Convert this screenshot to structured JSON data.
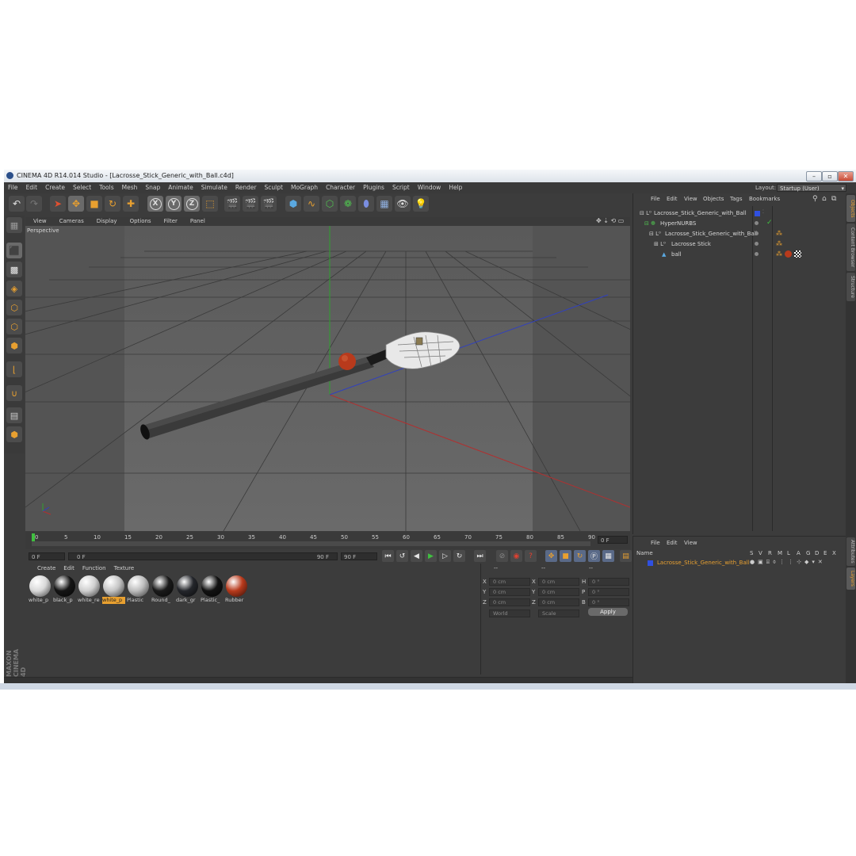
{
  "window": {
    "title": "CINEMA 4D R14.014 Studio - [Lacrosse_Stick_Generic_with_Ball.c4d]"
  },
  "menu": [
    "File",
    "Edit",
    "Create",
    "Select",
    "Tools",
    "Mesh",
    "Snap",
    "Animate",
    "Simulate",
    "Render",
    "Sculpt",
    "MoGraph",
    "Character",
    "Plugins",
    "Script",
    "Window",
    "Help"
  ],
  "layout": {
    "label": "Layout:",
    "value": "Startup (User)"
  },
  "viewport": {
    "menu": [
      "View",
      "Cameras",
      "Display",
      "Options",
      "Filter",
      "Panel"
    ],
    "label": "Perspective"
  },
  "timeline": {
    "ticks": [
      "0",
      "5",
      "10",
      "15",
      "20",
      "25",
      "30",
      "35",
      "40",
      "45",
      "50",
      "55",
      "60",
      "65",
      "70",
      "75",
      "80",
      "85",
      "90"
    ],
    "current_frame": "0 F",
    "start_field": "0 F",
    "range_start": "0 F",
    "range_end": "90 F",
    "end_field": "90 F"
  },
  "materials": {
    "menu": [
      "Create",
      "Edit",
      "Function",
      "Texture"
    ],
    "items": [
      {
        "label": "white_p",
        "color": "#d9d9d9"
      },
      {
        "label": "black_p",
        "color": "#151515"
      },
      {
        "label": "white_re",
        "color": "#cfcfcf"
      },
      {
        "label": "white_p",
        "color": "#c4c4c4",
        "selected": true
      },
      {
        "label": "Plastic",
        "color": "#bdbdbd"
      },
      {
        "label": "Round_",
        "color": "#1a1a1a"
      },
      {
        "label": "dark_gr",
        "color": "#24262b"
      },
      {
        "label": "Plastic_",
        "color": "#121212"
      },
      {
        "label": "Rubber",
        "color": "#b83a1c"
      }
    ]
  },
  "coordinates": {
    "header": [
      "--",
      "--",
      "--"
    ],
    "rows": [
      {
        "a": "X",
        "av": "0 cm",
        "b": "X",
        "bv": "0 cm",
        "c": "H",
        "cv": "0 °"
      },
      {
        "a": "Y",
        "av": "0 cm",
        "b": "Y",
        "bv": "0 cm",
        "c": "P",
        "cv": "0 °"
      },
      {
        "a": "Z",
        "av": "0 cm",
        "b": "Z",
        "bv": "0 cm",
        "c": "B",
        "cv": "0 °"
      }
    ],
    "mode1": "World",
    "mode2": "Scale",
    "apply": "Apply"
  },
  "objects": {
    "menu": [
      "File",
      "Edit",
      "View",
      "Objects",
      "Tags",
      "Bookmarks"
    ],
    "tree": [
      {
        "name": "Lacrosse_Stick_Generic_with_Ball",
        "indent": 0
      },
      {
        "name": "HyperNURBS",
        "indent": 1
      },
      {
        "name": "Lacrosse_Stick_Generic_with_Ball",
        "indent": 2
      },
      {
        "name": "Lacrosse Stick",
        "indent": 3
      },
      {
        "name": "ball",
        "indent": 3
      }
    ]
  },
  "attributes": {
    "menu": [
      "File",
      "Edit",
      "View"
    ],
    "columns": [
      "Name",
      "S",
      "V",
      "R",
      "M",
      "L",
      "A",
      "G",
      "D",
      "E",
      "X"
    ],
    "row": "Lacrosse_Stick_Generic_with_Ball"
  },
  "side_tabs": [
    "Objects",
    "Content Browser",
    "Structure",
    "Attributes",
    "Layers"
  ],
  "brand": "MAXON CINEMA 4D"
}
